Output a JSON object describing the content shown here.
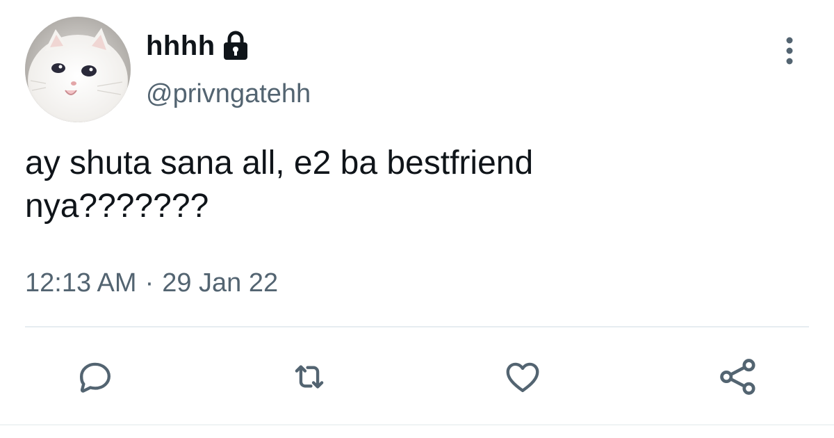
{
  "author": {
    "display_name": "hhhh",
    "handle": "@privngatehh",
    "avatar_icon": "crying-cat-avatar",
    "protected_icon": "lock-icon"
  },
  "tweet": {
    "text": "ay shuta sana all, e2 ba bestfriend\nnya???????",
    "time": "12:13 AM",
    "separator": "·",
    "date": "29 Jan 22"
  },
  "actions": {
    "reply_icon": "reply-icon",
    "retweet_icon": "retweet-icon",
    "like_icon": "heart-icon",
    "share_icon": "share-icon"
  },
  "menu": {
    "more_icon": "more-vertical-icon"
  },
  "colors": {
    "text_primary": "#0f1419",
    "text_secondary": "#536471",
    "divider": "#e6ecf0"
  }
}
